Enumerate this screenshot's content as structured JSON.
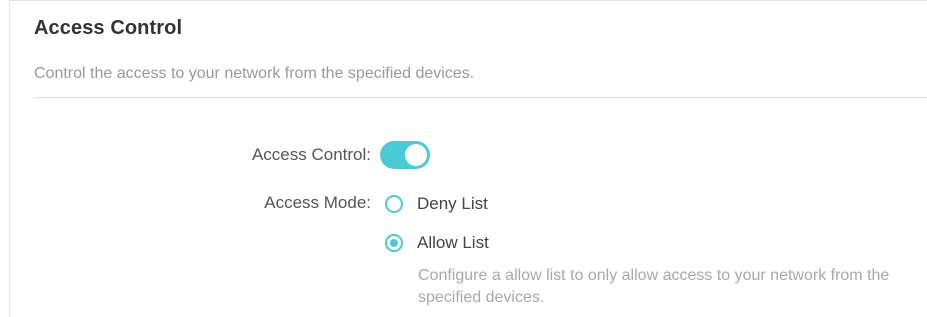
{
  "section": {
    "title": "Access Control",
    "description": "Control the access to your network from the specified devices."
  },
  "form": {
    "access_control_label": "Access Control:",
    "access_control_enabled": true,
    "access_mode_label": "Access Mode:",
    "modes": [
      {
        "label": "Deny List",
        "selected": false
      },
      {
        "label": "Allow List",
        "selected": true
      }
    ],
    "allow_hint": "Configure a allow list to only allow access to your network from the specified devices."
  },
  "colors": {
    "accent": "#4acbd6"
  }
}
